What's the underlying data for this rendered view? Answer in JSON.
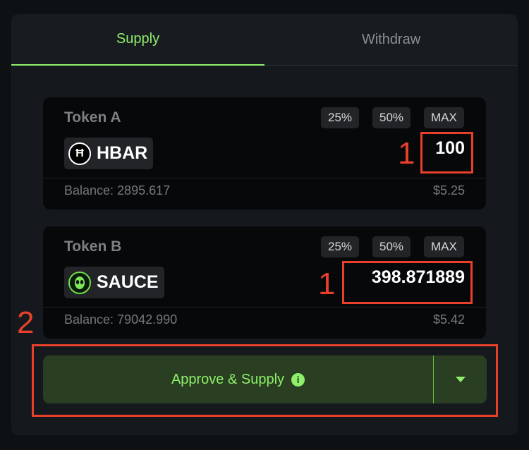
{
  "tabs": [
    {
      "label": "Supply",
      "active": true
    },
    {
      "label": "Withdraw",
      "active": false
    }
  ],
  "token_a": {
    "label": "Token A",
    "pct_buttons": [
      "25%",
      "50%",
      "MAX"
    ],
    "symbol": "HBAR",
    "icon": "hbar-icon",
    "amount": "100",
    "balance": "Balance: 2895.617",
    "usd": "$5.25"
  },
  "token_b": {
    "label": "Token B",
    "pct_buttons": [
      "25%",
      "50%",
      "MAX"
    ],
    "symbol": "SAUCE",
    "icon": "sauce-alien-icon",
    "amount": "398.871889",
    "balance": "Balance: 79042.990",
    "usd": "$5.42"
  },
  "action": {
    "label": "Approve & Supply",
    "info_icon": "i"
  },
  "annotations": {
    "a": "1",
    "b": "1",
    "c": "2"
  },
  "colors": {
    "accent": "#8ef06a",
    "annotation": "#e8402a",
    "button_bg": "#2a3f22"
  }
}
